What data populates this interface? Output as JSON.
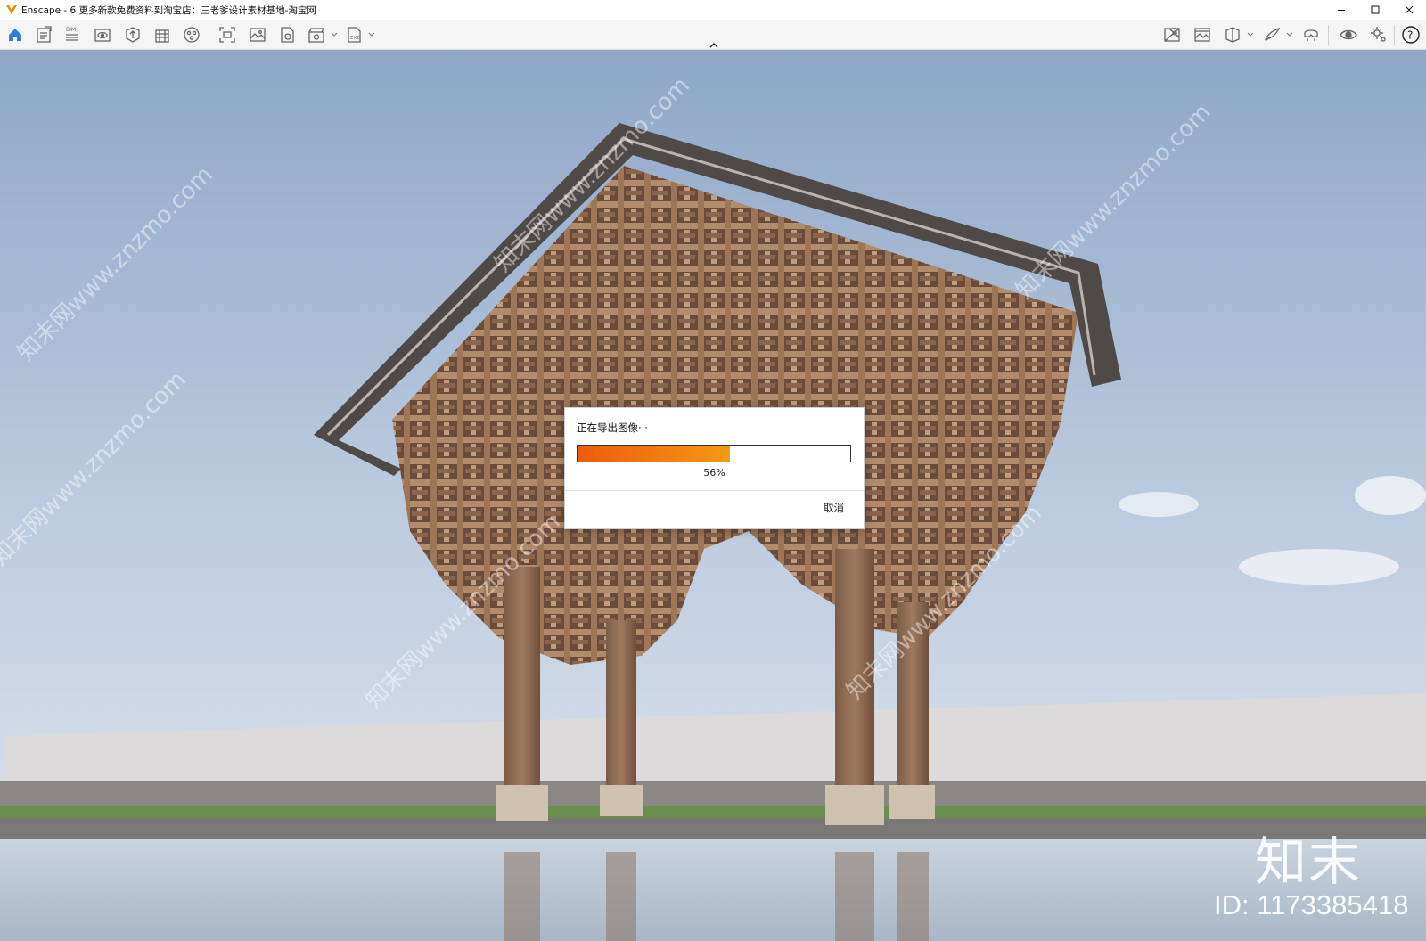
{
  "window": {
    "title": "Enscape - 6  更多新款免费资料到淘宝店：三老爹设计素材基地-淘宝网",
    "controls": [
      "minimize-icon",
      "maximize-icon",
      "close-icon"
    ]
  },
  "toolbar": {
    "left_icons": [
      "home-icon",
      "document-icon",
      "bim-icon",
      "view-icon",
      "asset-library-icon",
      "building-icon",
      "material-icon",
      "screenshot-icon",
      "image-icon",
      "panorama-icon",
      "video-icon",
      "exe-export-icon"
    ],
    "right_icons": [
      "map-icon",
      "image-settings-icon",
      "section-box-icon",
      "sketch-mode-icon",
      "vr-headset-icon",
      "visibility-icon",
      "settings-icon",
      "help-icon"
    ],
    "collapse_icon": "chevron-up-icon"
  },
  "dialog": {
    "title": "正在导出图像···",
    "progress": 0.56,
    "progress_label": "56%",
    "cancel_label": "取消",
    "accent_start": "#ee5a10",
    "accent_end": "#f39a12"
  },
  "watermark": {
    "logo": "知末",
    "id": "ID: 1173385418",
    "site": "知末网www.znzmo.com"
  },
  "colors": {
    "sky_top": "#8faacb",
    "sky_bottom": "#dfe4ec",
    "home_accent": "#2f7fdc",
    "app_icon": "#f08a00"
  }
}
